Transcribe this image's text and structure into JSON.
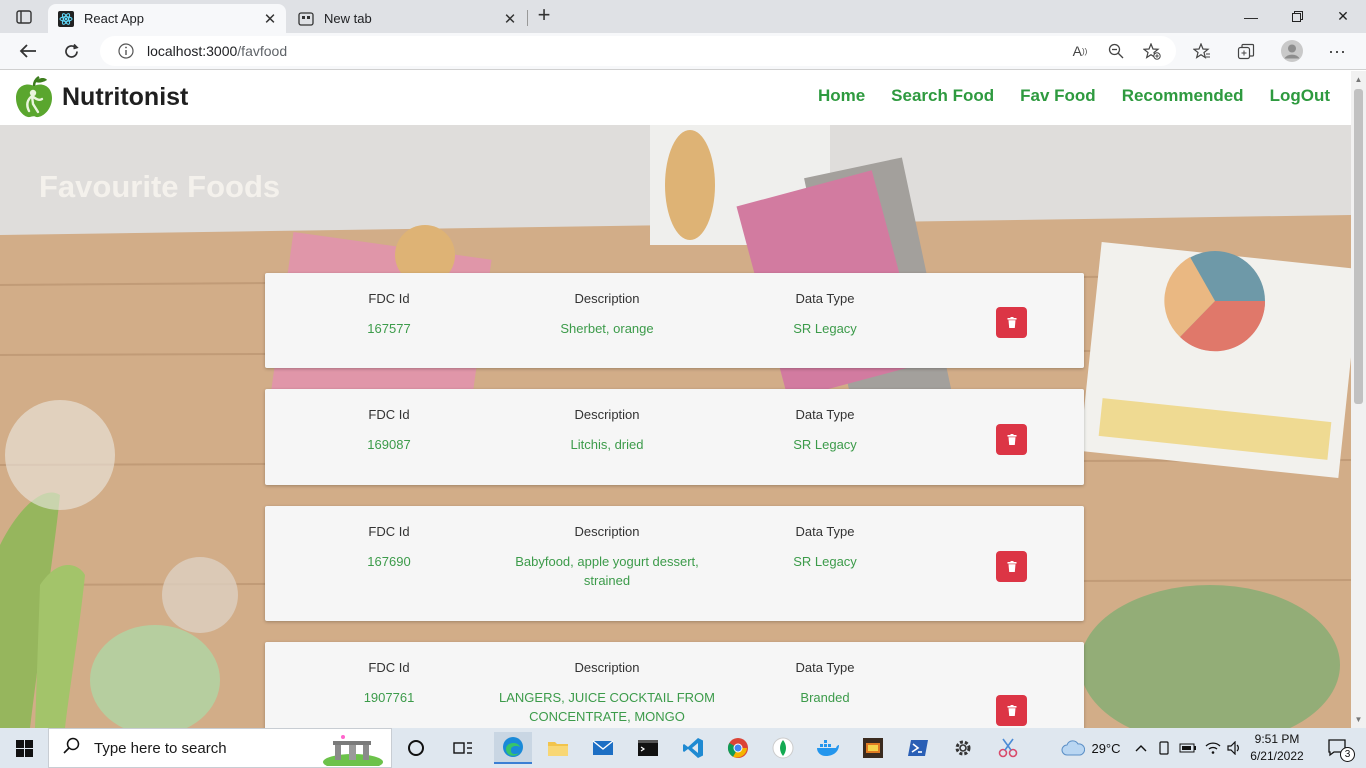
{
  "browser": {
    "tabs": [
      {
        "title": "React App",
        "active": true
      },
      {
        "title": "New tab",
        "active": false
      }
    ],
    "url_host": "localhost:3000",
    "url_path": "/favfood"
  },
  "app": {
    "brand": "Nutritonist",
    "nav": [
      "Home",
      "Search Food",
      "Fav Food",
      "Recommended",
      "LogOut"
    ],
    "page_title": "Favourite Foods",
    "accent_color": "#2e9a3f",
    "delete_color": "#dc3545",
    "columns": {
      "fdc_id": "FDC Id",
      "description": "Description",
      "data_type": "Data Type"
    },
    "foods": [
      {
        "fdc_id": "167577",
        "description": "Sherbet, orange",
        "data_type": "SR Legacy"
      },
      {
        "fdc_id": "169087",
        "description": "Litchis, dried",
        "data_type": "SR Legacy"
      },
      {
        "fdc_id": "167690",
        "description": "Babyfood, apple yogurt dessert, strained",
        "data_type": "SR Legacy"
      },
      {
        "fdc_id": "1907761",
        "description": "LANGERS, JUICE COCKTAIL FROM CONCENTRATE, MONGO",
        "data_type": "Branded"
      }
    ]
  },
  "taskbar": {
    "search_placeholder": "Type here to search",
    "weather": "29°C",
    "time": "9:51 PM",
    "date": "6/21/2022",
    "notifications": "3"
  }
}
